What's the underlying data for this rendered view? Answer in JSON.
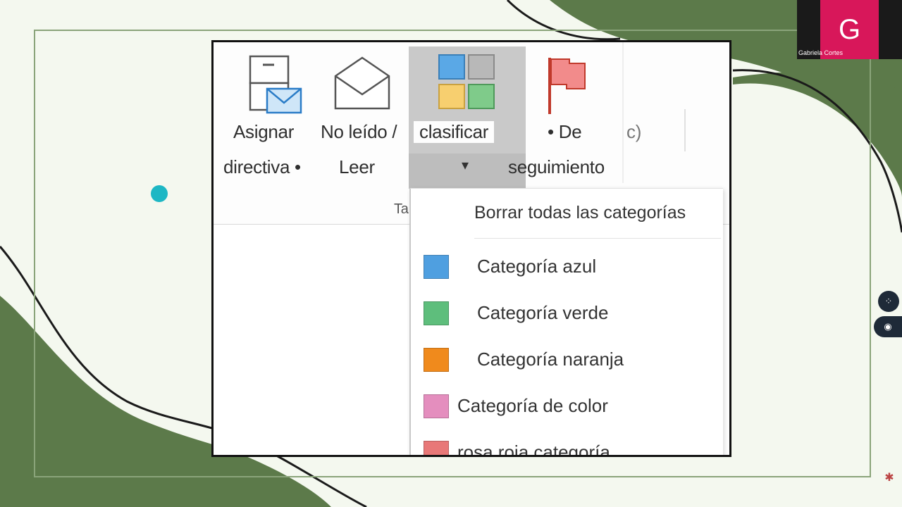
{
  "ribbon": {
    "assign_policy": {
      "line1": "Asignar",
      "line2": "directiva •"
    },
    "unread_read": {
      "line1": "No leído /",
      "line2": "Leer"
    },
    "categorize": {
      "line1": "clasificar",
      "arrow": "▾"
    },
    "follow_up": {
      "line1": "• De",
      "line2": "seguimiento"
    },
    "partial_right": "c)",
    "group_label_fragment": "Ta"
  },
  "categorize_menu": {
    "clear_all": "Borrar todas las categorías",
    "items": [
      {
        "label": "Categoría azul",
        "color": "#4f9fe0"
      },
      {
        "label": "Categoría verde",
        "color": "#5ebe7c"
      },
      {
        "label": "Categoría naranja",
        "color": "#f08a1c"
      },
      {
        "label": "Categoría de color",
        "color": "#e48ebe"
      },
      {
        "label": "rosa roja categoría",
        "color": "#e87878"
      }
    ]
  },
  "video_call": {
    "avatar_letter": "G",
    "participant_name": "Gabriela Cortes",
    "avatar_color": "#d8175a"
  },
  "colors": {
    "background": "#f4f8ef",
    "decor_green": "#5c7a4a"
  }
}
